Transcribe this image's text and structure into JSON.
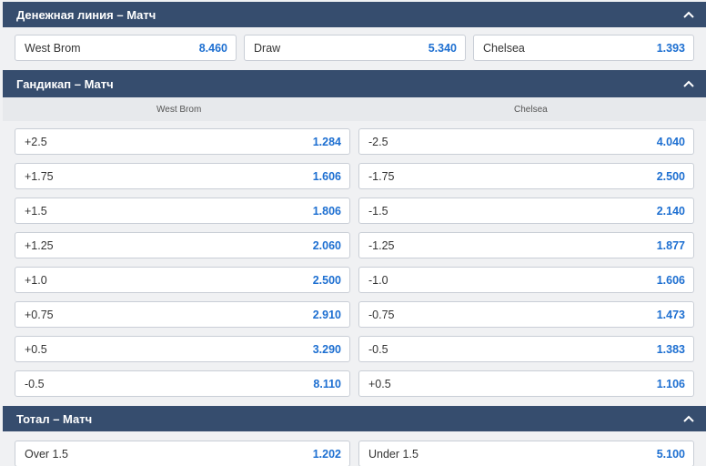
{
  "moneyline": {
    "title": "Денежная линия – Матч",
    "options": [
      {
        "label": "West Brom",
        "odds": "8.460"
      },
      {
        "label": "Draw",
        "odds": "5.340"
      },
      {
        "label": "Chelsea",
        "odds": "1.393"
      }
    ]
  },
  "handicap": {
    "title": "Гандикап – Матч",
    "team_home": "West Brom",
    "team_away": "Chelsea",
    "rows": [
      {
        "home_line": "+2.5",
        "home_odds": "1.284",
        "away_line": "-2.5",
        "away_odds": "4.040"
      },
      {
        "home_line": "+1.75",
        "home_odds": "1.606",
        "away_line": "-1.75",
        "away_odds": "2.500"
      },
      {
        "home_line": "+1.5",
        "home_odds": "1.806",
        "away_line": "-1.5",
        "away_odds": "2.140"
      },
      {
        "home_line": "+1.25",
        "home_odds": "2.060",
        "away_line": "-1.25",
        "away_odds": "1.877"
      },
      {
        "home_line": "+1.0",
        "home_odds": "2.500",
        "away_line": "-1.0",
        "away_odds": "1.606"
      },
      {
        "home_line": "+0.75",
        "home_odds": "2.910",
        "away_line": "-0.75",
        "away_odds": "1.473"
      },
      {
        "home_line": "+0.5",
        "home_odds": "3.290",
        "away_line": "-0.5",
        "away_odds": "1.383"
      },
      {
        "home_line": "-0.5",
        "home_odds": "8.110",
        "away_line": "+0.5",
        "away_odds": "1.106"
      }
    ]
  },
  "total": {
    "title": "Тотал – Матч",
    "rows": [
      {
        "over_label": "Over 1.5",
        "over_odds": "1.202",
        "under_label": "Under 1.5",
        "under_odds": "5.100"
      }
    ]
  },
  "icons": {
    "collapse": "chevron-up-icon"
  },
  "colors": {
    "header_bg": "#364d6e",
    "odds_text": "#1d6fd1",
    "page_bg": "#f0f1f3"
  }
}
